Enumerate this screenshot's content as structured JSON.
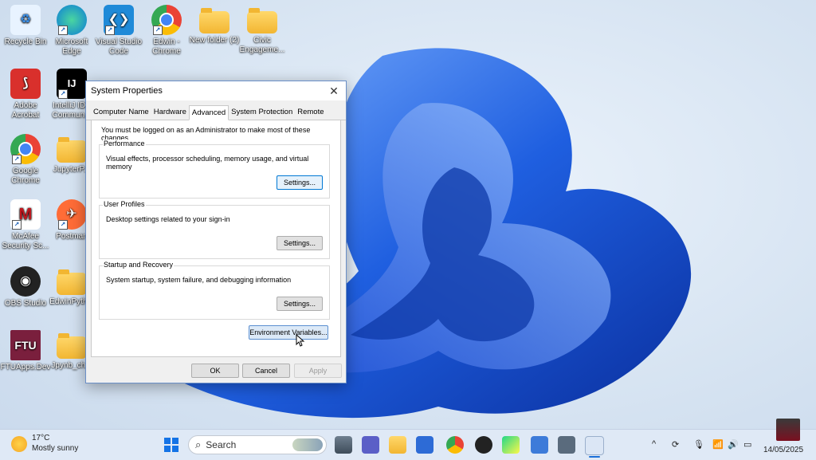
{
  "desktop": {
    "icons": [
      {
        "label": "Recycle Bin",
        "name": "recycle-bin-icon"
      },
      {
        "label": "Microsoft Edge",
        "name": "edge-icon"
      },
      {
        "label": "Visual Studio Code",
        "name": "vscode-icon"
      },
      {
        "label": "Edwin - Chrome",
        "name": "chrome-profile-icon"
      },
      {
        "label": "New folder (2)",
        "name": "folder-icon"
      },
      {
        "label": "Civic Engageme...",
        "name": "folder-icon"
      },
      {
        "label": "Adobe Acrobat",
        "name": "acrobat-icon"
      },
      {
        "label": "IntelliJ IDE Commun...",
        "name": "intellij-icon"
      },
      {
        "label": "Google Chrome",
        "name": "chrome-icon"
      },
      {
        "label": "JupyterP...",
        "name": "folder-icon"
      },
      {
        "label": "McAfee Security Sc...",
        "name": "mcafee-icon"
      },
      {
        "label": "Postman",
        "name": "postman-icon"
      },
      {
        "label": "OBS Studio",
        "name": "obs-icon"
      },
      {
        "label": "EdwinPyth...",
        "name": "folder-icon"
      },
      {
        "label": "FTUApps.Dev",
        "name": "ftu-icon"
      },
      {
        "label": "Jpynb_ch...",
        "name": "folder-icon"
      }
    ],
    "ftu_text": "FTU",
    "intellij_text": "IJ"
  },
  "dialog": {
    "title": "System Properties",
    "close_glyph": "✕",
    "tabs": [
      "Computer Name",
      "Hardware",
      "Advanced",
      "System Protection",
      "Remote"
    ],
    "active_tab": "Advanced",
    "note": "You must be logged on as an Administrator to make most of these changes.",
    "groups": [
      {
        "title": "Performance",
        "desc": "Visual effects, processor scheduling, memory usage, and virtual memory",
        "button": "Settings..."
      },
      {
        "title": "User Profiles",
        "desc": "Desktop settings related to your sign-in",
        "button": "Settings..."
      },
      {
        "title": "Startup and Recovery",
        "desc": "System startup, system failure, and debugging information",
        "button": "Settings..."
      }
    ],
    "env_button": "Environment Variables...",
    "ok": "OK",
    "cancel": "Cancel",
    "apply": "Apply"
  },
  "taskbar": {
    "weather_temp": "17°C",
    "weather_desc": "Mostly sunny",
    "search_placeholder": "Search",
    "date": "14/05/2025",
    "tray_chevron": "^"
  }
}
